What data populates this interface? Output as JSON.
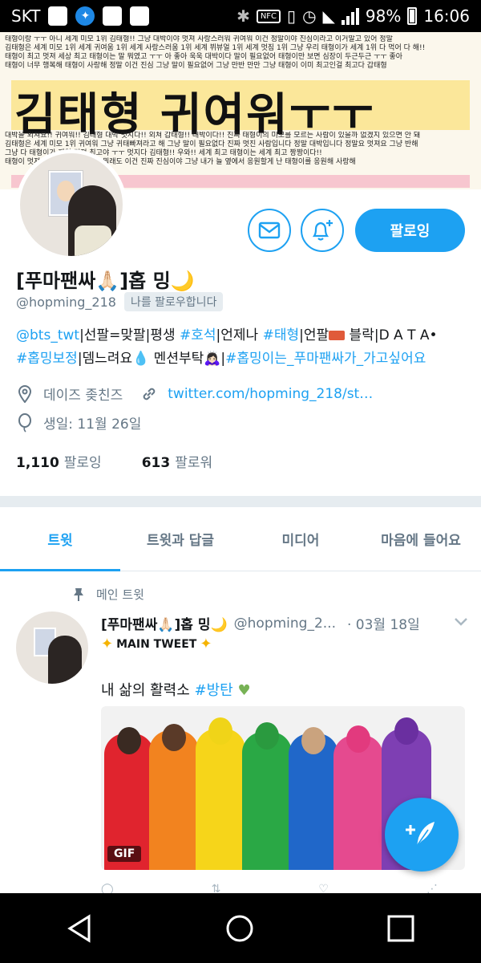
{
  "status_bar": {
    "carrier": "SKT",
    "battery": "98%",
    "time": "16:06",
    "nfc": "NFC"
  },
  "banner": {
    "title": "김태형 귀여워ㅜㅜ",
    "line_top_1": "태형이랑 ㅜㅜ 아니 세계 미모 1위 김태형!! 그냥 대박이야 멋져 사랑스러워 귀여워 이건 정말이야 진심이라고 이거말고 있어 정말",
    "line_top_2": "김태형은 세계 미모 1위 세계 귀여움 1위 세계 사랑스러움 1위 세계 뷔뷰얼 1위 세계 멋짐 1위 그냥 우리 태형이가 세계 1위 다 먹어 다 해!!",
    "line_top_3": "태형이 최고 멋져 세상 최고 태형이는 말 뭐였고 ㅜㅜ 아 좋아 욱욱 대박이다 말이 필요없어 태형이만 보면 심장이 두근두근 ㅜㅜ 좋아",
    "line_top_4": "태형이 너무 행복해 태형이 사랑해 정말 이건 진심 그냥 말이 필요없어 그냥 만반 만만 그냥 태형이 이미 최고인걸 최고다 갑태형",
    "line_bot_1": "대박을 외쳐요!! 귀여워!! 김태형 대박 멋지다!! 외쳐 갑태형!! 대박이다!! 진짜 태형이의 미모를 모르는 사람이 있을까 없겠지 있으면 안 돼",
    "line_bot_2": "김태형은 세계 미모 1위 귀여워 그냥 귀태빠져라고 해 그냥 말이 필요없다 진짜 멋진 사람입니다 정말 대박입니다 정말요 멋져요 그냥 반해",
    "line_bot_3": "그냥 다 태형이가 제일 멋져 최고야 ㅜㅜ 멋지다 김태형!! 우와!! 세계 최고 태형이는 세계 최고 짱짱이다!!",
    "line_bot_4": "태형이 멋져 태형이 사랑해 누가 뭐래도 이건 진짜 진심이야 그냥 내가 늘 옆에서 응원할게 난 태형이를 응원해 사랑해"
  },
  "profile": {
    "name": "[푸마팬싸🙏🏻]홉 밍🌙",
    "handle": "@hopming_218",
    "follows_you": "나를 팔로우합니다",
    "follow_button": "팔로잉",
    "bio_line1": {
      "tag1": "@bts_twt",
      "text1": "|선팔=맞팔|평생 ",
      "tag2": "#호석",
      "text2": "|언제나 ",
      "tag3": "#태형",
      "text3": "|언팔",
      "text4": " 블락|D A T A•"
    },
    "bio_line2": {
      "tag1": "#홉밍보정",
      "text1": "|뎀느려요",
      "text2": " 멘션부탁🙇🏻‍♀️|",
      "tag2": "#홉밍이는_푸마팬싸가_가고싶어요"
    },
    "location": "데이즈 좆친즈",
    "url": "twitter.com/hopming_218/st…",
    "birthday": "생일: 11월 26일",
    "following_count": "1,110",
    "following_label": "팔로잉",
    "followers_count": "613",
    "followers_label": "팔로워"
  },
  "tabs": [
    {
      "label": "트윗",
      "active": true
    },
    {
      "label": "트윗과 답글",
      "active": false
    },
    {
      "label": "미디어",
      "active": false
    },
    {
      "label": "마음에 들어요",
      "active": false
    }
  ],
  "pinned_tweet": {
    "pin_label": "메인 트윗",
    "name": "[푸마팬싸🙏🏻]홉 밍🌙",
    "handle": "@hopming_2...",
    "date": "· 03월 18일",
    "main_label": "MAIN TWEET",
    "text_prefix": "내 삶의 활력소 ",
    "hashtag": "#방탄",
    "gif_badge": "GIF"
  },
  "colors": {
    "accent": "#1da1f2",
    "banner_yellow": "#fbe79a",
    "banner_pink": "#f7c6cf"
  },
  "icons": {
    "message": "envelope-icon",
    "bell": "bell-plus-icon",
    "location": "location-pin-icon",
    "link": "link-icon",
    "birthday": "balloon-icon",
    "pin": "pin-icon",
    "compose": "feather-plus-icon"
  }
}
